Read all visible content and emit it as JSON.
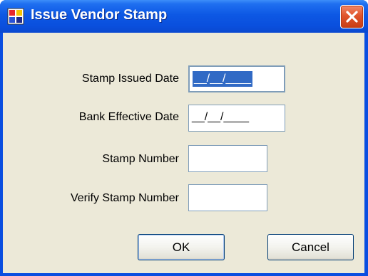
{
  "window": {
    "title": "Issue Vendor Stamp",
    "icon": "app-window-icon",
    "close_icon": "close-x-icon",
    "colors": {
      "titlebar": "#0a4fdd",
      "client": "#ece9d8",
      "close": "#e0542c",
      "selection": "#316ac5"
    }
  },
  "form": {
    "stamp_issued_date": {
      "label": "Stamp Issued Date",
      "value": "__/__/____"
    },
    "bank_effective_date": {
      "label": "Bank Effective Date",
      "value": "__/__/____"
    },
    "stamp_number": {
      "label": "Stamp Number",
      "value": ""
    },
    "verify_stamp_number": {
      "label": "Verify Stamp Number",
      "value": ""
    }
  },
  "buttons": {
    "ok": "OK",
    "cancel": "Cancel"
  }
}
